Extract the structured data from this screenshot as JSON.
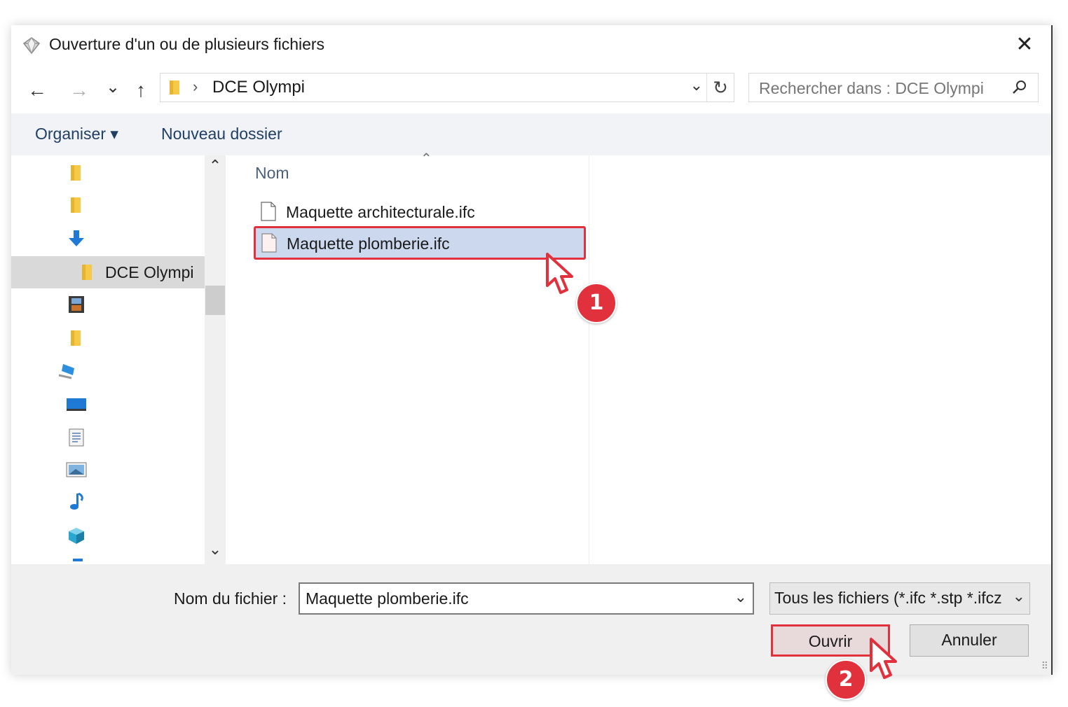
{
  "window": {
    "title": "Ouverture d'un ou de plusieurs fichiers",
    "close_icon": "close-icon"
  },
  "nav": {
    "back_icon": "←",
    "forward_icon": "→",
    "recent_icon": "⌄",
    "up_icon": "↑",
    "path_separator": "›",
    "path": "DCE Olympi",
    "dropdown_icon": "⌄",
    "refresh_icon": "↻",
    "search_placeholder": "Rechercher dans : DCE Olympi",
    "search_icon": "⚲"
  },
  "toolbar": {
    "organize": "Organiser ▾",
    "new_folder": "Nouveau dossier"
  },
  "sidebar": {
    "items": [
      {
        "icon": "folder-icon",
        "label": ""
      },
      {
        "icon": "folder-icon",
        "label": ""
      },
      {
        "icon": "download-icon",
        "label": ""
      },
      {
        "icon": "folder-icon",
        "label": "DCE Olympi",
        "selected": true
      },
      {
        "icon": "video-icon",
        "label": ""
      },
      {
        "icon": "folder-icon",
        "label": ""
      },
      {
        "icon": "computer-icon",
        "label": ""
      },
      {
        "icon": "desktop-icon",
        "label": ""
      },
      {
        "icon": "document-icon",
        "label": ""
      },
      {
        "icon": "pictures-icon",
        "label": ""
      },
      {
        "icon": "music-icon",
        "label": ""
      },
      {
        "icon": "3d-objects-icon",
        "label": ""
      }
    ],
    "scroll_up": "⌃",
    "scroll_down": "⌄"
  },
  "files": {
    "column_name": "Nom",
    "sort_arrow": "⌃",
    "rows": [
      {
        "name": "Maquette architecturale.ifc",
        "selected": false
      },
      {
        "name": "Maquette plomberie.ifc",
        "selected": true
      }
    ]
  },
  "footer": {
    "filename_label": "Nom du fichier :",
    "filename_value": "Maquette plomberie.ifc",
    "filter_value": "Tous les fichiers (*.ifc *.stp *.ifcz",
    "dropdown_icon": "⌄",
    "open_button": "Ouvrir",
    "cancel_button": "Annuler"
  },
  "annotations": {
    "step1": "1",
    "step2": "2",
    "highlight_color": "#e1313d"
  }
}
